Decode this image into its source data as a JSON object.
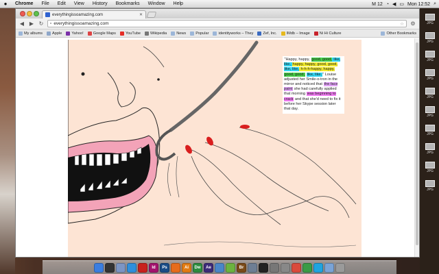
{
  "menubar": {
    "apple": "",
    "app_name": "Chrome",
    "items": [
      "File",
      "Edit",
      "View",
      "History",
      "Bookmarks",
      "Window",
      "Help"
    ],
    "status": {
      "m_badge": "M 12",
      "clock": "Mon 12:52"
    }
  },
  "browser": {
    "tab_title": "everythingissoamazing.com",
    "url": "everythingissoamazing.com",
    "bookmarks": [
      {
        "label": "My albums",
        "icon": "folder-icon"
      },
      {
        "label": "Apple",
        "icon": "apple-icon"
      },
      {
        "label": "Yahoo!",
        "icon": "yahoo-icon"
      },
      {
        "label": "Google Maps",
        "icon": "google-icon"
      },
      {
        "label": "YouTube",
        "icon": "youtube-icon"
      },
      {
        "label": "Wikipedia",
        "icon": "wiki-icon"
      },
      {
        "label": "News",
        "icon": "folder-icon"
      },
      {
        "label": "Popular",
        "icon": "folder-icon"
      },
      {
        "label": "identityworks – They",
        "icon": "folder-icon"
      },
      {
        "label": "Zef, Inc.",
        "icon": "zef-icon"
      },
      {
        "label": "IMdb – Image",
        "icon": "imdb-icon"
      },
      {
        "label": "Ni Hi Culture",
        "icon": "pin-icon"
      }
    ],
    "other_bookmarks": "Other Bookmarks"
  },
  "comic": {
    "caption": [
      {
        "text": "\"Happy, happy, ",
        "hl": ""
      },
      {
        "text": "good, good,",
        "hl": "green"
      },
      {
        "text": " like, like, ",
        "hl": "cyan"
      },
      {
        "text": "happy, happy, good, good, ",
        "hl": "yellow"
      },
      {
        "text": "like, like,",
        "hl": "cyan"
      },
      {
        "text": " h-h-h-happy, happy, ",
        "hl": "yellow"
      },
      {
        "text": "good, good,",
        "hl": "green"
      },
      {
        "text": " ",
        "hl": ""
      },
      {
        "text": "like, like.",
        "hl": "cyan"
      },
      {
        "text": "\" Louise adjusted her Smile-o-tron in the mirror and noticed that ",
        "hl": ""
      },
      {
        "text": "the face paint",
        "hl": "violet"
      },
      {
        "text": " she had carefully applied that morning ",
        "hl": ""
      },
      {
        "text": "was beginning to crack",
        "hl": "pink"
      },
      {
        "text": " and that she'd need to fix it before her Skype session later that day.",
        "hl": ""
      }
    ]
  },
  "desktop_files": [
    "JPG",
    "JPG",
    "JPG",
    "JPG",
    "JPG",
    "JPG",
    "JPG",
    "JPG",
    "JPG",
    "JPG"
  ],
  "dock": [
    {
      "icon": "finder-icon",
      "label": "",
      "color": "#3b7ee0"
    },
    {
      "icon": "dashboard-icon",
      "label": "",
      "color": "#333333"
    },
    {
      "icon": "mail-icon",
      "label": "",
      "color": "#7c95c4"
    },
    {
      "icon": "safari-icon",
      "label": "",
      "color": "#2f8fdc"
    },
    {
      "icon": "acrobat-icon",
      "label": "",
      "color": "#c8211d"
    },
    {
      "icon": "indesign-icon",
      "label": "Id",
      "color": "#a3126d"
    },
    {
      "icon": "photoshop-icon",
      "label": "Ps",
      "color": "#1a4c86"
    },
    {
      "icon": "firefox-icon",
      "label": "",
      "color": "#e66c1b"
    },
    {
      "icon": "illustrator-icon",
      "label": "Ai",
      "color": "#e07b13"
    },
    {
      "icon": "dreamweaver-icon",
      "label": "Dw",
      "color": "#2d8c3f"
    },
    {
      "icon": "aftereffects-icon",
      "label": "Ae",
      "color": "#3c2a78"
    },
    {
      "icon": "itunes-icon",
      "label": "",
      "color": "#4a86c8"
    },
    {
      "icon": "spotify-icon",
      "label": "",
      "color": "#6cb33f"
    },
    {
      "icon": "bridge-icon",
      "label": "Br",
      "color": "#7a4a18"
    },
    {
      "icon": "preview-icon",
      "label": "",
      "color": "#6e7e94"
    },
    {
      "icon": "terminal-icon",
      "label": "",
      "color": "#222222"
    },
    {
      "icon": "system-prefs-icon",
      "label": "",
      "color": "#777777"
    },
    {
      "icon": "disk-utility-icon",
      "label": "",
      "color": "#888888"
    },
    {
      "icon": "calendar-icon",
      "label": "",
      "color": "#d94a3b"
    },
    {
      "icon": "chrome-icon",
      "label": "",
      "color": "#3a9b46"
    },
    {
      "icon": "skype-icon",
      "label": "",
      "color": "#1fa4e0"
    },
    {
      "icon": "folder-icon",
      "label": "",
      "color": "#7aa3d6"
    },
    {
      "icon": "trash-icon",
      "label": "",
      "color": "#9a9a9a"
    }
  ]
}
